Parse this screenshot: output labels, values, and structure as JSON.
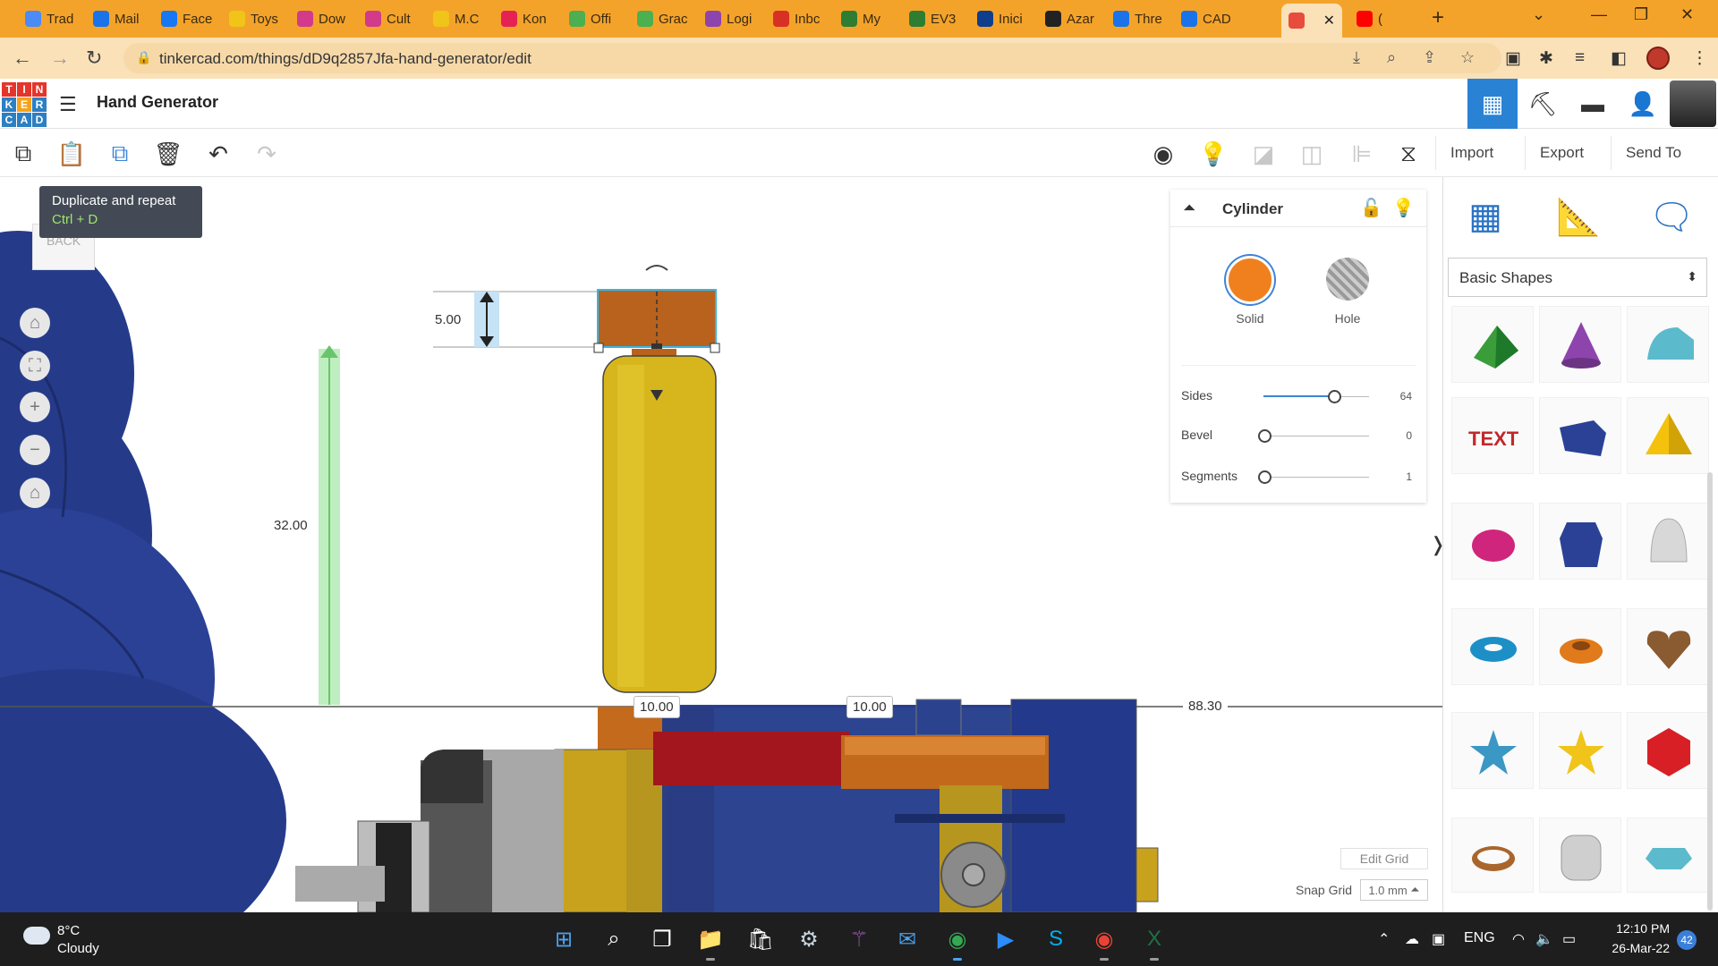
{
  "browser": {
    "tabs": [
      {
        "label": "Trad",
        "color": "#4b8bf5"
      },
      {
        "label": "Mail",
        "color": "#1a73e8"
      },
      {
        "label": "Face",
        "color": "#1877f2"
      },
      {
        "label": "Toys",
        "color": "#f0c419"
      },
      {
        "label": "Dow",
        "color": "#d23a8c"
      },
      {
        "label": "Cult",
        "color": "#d23a8c"
      },
      {
        "label": "M.C",
        "color": "#f0c419"
      },
      {
        "label": "Kon",
        "color": "#e62255"
      },
      {
        "label": "Offi",
        "color": "#4caf50"
      },
      {
        "label": "Grac",
        "color": "#4caf50"
      },
      {
        "label": "Logi",
        "color": "#8e44ad"
      },
      {
        "label": "Inbc",
        "color": "#d93025"
      },
      {
        "label": "My",
        "color": "#2e7d32"
      },
      {
        "label": "EV3",
        "color": "#2e7d32"
      },
      {
        "label": "Inici",
        "color": "#0f3f8c"
      },
      {
        "label": "Azar",
        "color": "#222222"
      },
      {
        "label": "Thre",
        "color": "#1a73e8"
      },
      {
        "label": "CAD",
        "color": "#1a73e8"
      },
      {
        "label": "",
        "color": "#e74c3c"
      },
      {
        "label": "(",
        "color": "#ff0000"
      }
    ],
    "url": "tinkercad.com/things/dD9q2857Jfa-hand-generator/edit"
  },
  "app": {
    "logo_letters": [
      "T",
      "I",
      "N",
      "K",
      "E",
      "R",
      "C",
      "A",
      "D"
    ],
    "logo_colors": [
      "#e5352b",
      "#e5352b",
      "#e5352b",
      "#2d7fc1",
      "#f6a21b",
      "#2d7fc1",
      "#2d7fc1",
      "#2d7fc1",
      "#2d7fc1"
    ],
    "design_title": "Hand Generator"
  },
  "toolbar": {
    "import_label": "Import",
    "export_label": "Export",
    "send_label": "Send To"
  },
  "tooltip": {
    "title": "Duplicate and repeat",
    "shortcut": "Ctrl + D"
  },
  "viewcube": {
    "label": "BACK"
  },
  "dimensions": {
    "height_top": "5.00",
    "height_total": "32.00",
    "width_a": "10.00",
    "width_b": "10.00",
    "offset": "88.30"
  },
  "inspector": {
    "title": "Cylinder",
    "solid_label": "Solid",
    "hole_label": "Hole",
    "props": [
      {
        "label": "Sides",
        "value": "64",
        "fraction": 0.66
      },
      {
        "label": "Bevel",
        "value": "0",
        "fraction": 0.0
      },
      {
        "label": "Segments",
        "value": "1",
        "fraction": 0.0
      }
    ]
  },
  "grid": {
    "edit_label": "Edit Grid",
    "snap_label": "Snap Grid",
    "snap_value": "1.0 mm"
  },
  "panel": {
    "category": "Basic Shapes"
  },
  "taskbar": {
    "temp": "8°C",
    "condition": "Cloudy",
    "lang": "ENG",
    "time": "12:10 PM",
    "date": "26-Mar-22",
    "notifications": "42"
  }
}
